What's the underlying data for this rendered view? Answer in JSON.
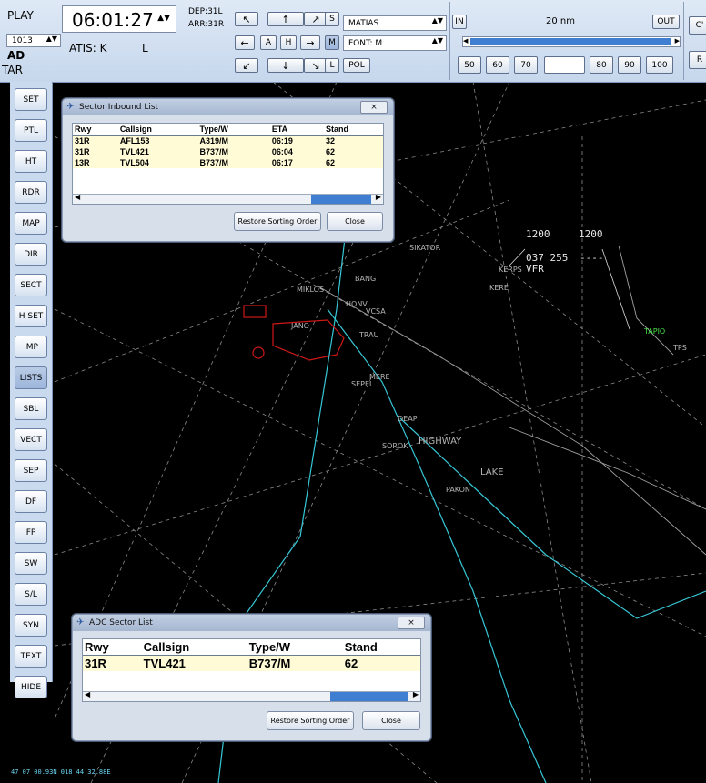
{
  "topbar": {
    "mode_label": "PLAY",
    "time": "06:01:27",
    "dep": "DEP:31L",
    "arr": "ARR:31R",
    "pressure": "1013",
    "ad_label": "AD",
    "tar_label": "TAR",
    "atis": "ATIS: K",
    "atis_l": "L",
    "s_button": "S",
    "m_button": "M",
    "l_button": "L",
    "a_button": "A",
    "h_button": "H",
    "user_select": "MATIAS",
    "font_select": "FONT: M",
    "pol_button": "POL",
    "in_button": "IN",
    "out_button": "OUT",
    "range_label": "20 nm",
    "range_presets": [
      "50",
      "60",
      "70",
      "",
      "80",
      "90",
      "100"
    ],
    "edge_button_c": "C'",
    "edge_button_r": "R"
  },
  "sidebar": [
    {
      "label": "SET"
    },
    {
      "label": "PTL"
    },
    {
      "label": "HT"
    },
    {
      "label": "RDR"
    },
    {
      "label": "MAP"
    },
    {
      "label": "DIR"
    },
    {
      "label": "SECT"
    },
    {
      "label": "H SET"
    },
    {
      "label": "IMP"
    },
    {
      "label": "LISTS"
    },
    {
      "label": "SBL"
    },
    {
      "label": "VECT"
    },
    {
      "label": "SEP"
    },
    {
      "label": "DF"
    },
    {
      "label": "FP"
    },
    {
      "label": "SW"
    },
    {
      "label": "S/L"
    },
    {
      "label": "SYN"
    },
    {
      "label": "TEXT"
    },
    {
      "label": "HIDE"
    }
  ],
  "radar": {
    "labels": {
      "sikator": "SIKATOR",
      "kerps": "KERPS",
      "kere": "KERE",
      "miklos": "MIKLOS",
      "bang": "BANG",
      "honv": "HONV",
      "vcsa": "VCSA",
      "jano": "JANO",
      "trau": "TRAU",
      "mere": "MERE",
      "sepel": "SEPEL",
      "deap": "DEAP",
      "sorok": "SOROK",
      "highway": "HIGHWAY",
      "lake": "LAKE",
      "pakon": "PAKON",
      "tapio": "TAPIO",
      "tps": "TPS"
    },
    "tag_alt1": "1200",
    "tag_alt2": "1200",
    "tag_line2": "037 255",
    "tag_line2b": "----",
    "tag_line3": "VFR",
    "coords": "47 07 00.93N   018 44 32.88E"
  },
  "inbound_list": {
    "title": "Sector Inbound List",
    "columns": [
      "Rwy",
      "Callsign",
      "Type/W",
      "ETA",
      "Stand"
    ],
    "rows": [
      [
        "31R",
        "AFL153",
        "A319/M",
        "06:19",
        "32"
      ],
      [
        "31R",
        "TVL421",
        "B737/M",
        "06:04",
        "62"
      ],
      [
        "13R",
        "TVL504",
        "B737/M",
        "06:17",
        "62"
      ]
    ],
    "restore_button": "Restore Sorting Order",
    "close_button": "Close"
  },
  "adc_list": {
    "title": "ADC Sector List",
    "columns": [
      "Rwy",
      "Callsign",
      "Type/W",
      "Stand"
    ],
    "rows": [
      [
        "31R",
        "TVL421",
        "B737/M",
        "62"
      ]
    ],
    "restore_button": "Restore Sorting Order",
    "close_button": "Close"
  },
  "colors": {
    "radar_bg": "#000000",
    "route_line": "#37c7d6",
    "restricted_area": "#d01818",
    "row_highlight": "#fffbd6",
    "scroll_thumb": "#3f7ed1"
  }
}
